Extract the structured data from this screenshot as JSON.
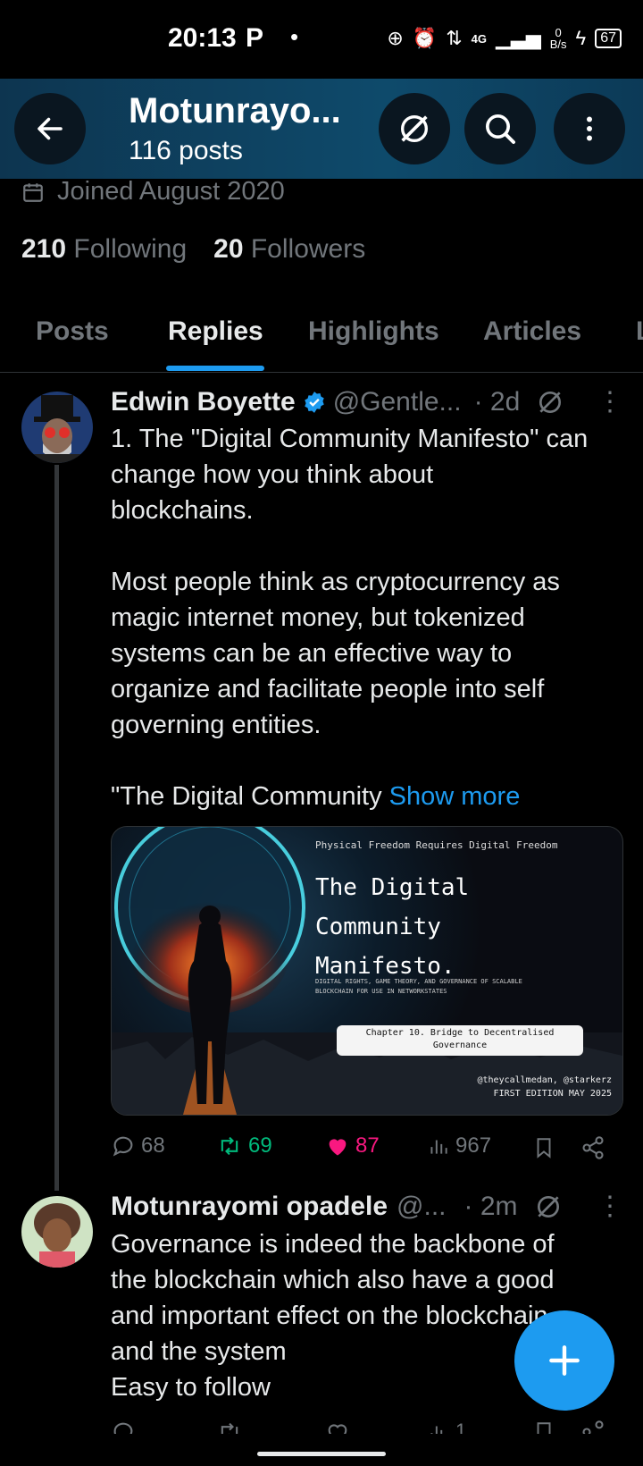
{
  "status_bar": {
    "time": "20:13",
    "p_icon": "P",
    "dot": "•",
    "network": "4G",
    "data_rate_top": "0",
    "data_rate_unit": "B/s",
    "battery": "67"
  },
  "header": {
    "name": "Motunrayo...",
    "posts": "116 posts"
  },
  "profile": {
    "joined": "Joined August 2020",
    "following_count": "210",
    "following_label": "Following",
    "followers_count": "20",
    "followers_label": "Followers"
  },
  "tabs": [
    "Posts",
    "Replies",
    "Highlights",
    "Articles",
    "L"
  ],
  "active_tab": "Replies",
  "tweet1": {
    "name": "Edwin Boyette",
    "handle": "@Gentle...",
    "time": "· 2d",
    "line1": "1. The \"Digital Community Manifesto\" can",
    "line2": "change how you think about",
    "line3": "blockchains.",
    "para2": [
      "Most people think as cryptocurrency as",
      "magic internet money, but tokenized",
      "systems can be an effective way to",
      "organize and facilitate people into self",
      "governing entities."
    ],
    "para3": "\"The Digital Community ",
    "show_more": "Show more",
    "media": {
      "top_line": "Physical Freedom Requires Digital Freedom",
      "title1": "The Digital",
      "title2": "Community",
      "title3": "Manifesto.",
      "subtitle1": "DIGITAL RIGHTS, GAME THEORY, AND GOVERNANCE OF SCALABLE",
      "subtitle2": "BLOCKCHAIN FOR USE IN NETWORKSTATES",
      "chapter1": "Chapter 10. Bridge to Decentralised",
      "chapter2": "Governance",
      "authors": "@theycallmedan, @starkerz",
      "edition": "FIRST EDITION MAY 2025"
    },
    "replies": "68",
    "reposts": "69",
    "likes": "87",
    "views": "967"
  },
  "tweet2": {
    "name": "Motunrayomi opadele",
    "handle": "@...",
    "time": "· 2m",
    "lines": [
      "Governance is indeed the backbone of",
      "the blockchain which also have a good",
      "and important effect on the blockchain",
      "and the system",
      "Easy to follow"
    ],
    "views_partial": "1"
  },
  "colors": {
    "accent": "#1d9bf0",
    "repost": "#00ba7c",
    "like": "#f91880",
    "muted": "#71767b"
  }
}
